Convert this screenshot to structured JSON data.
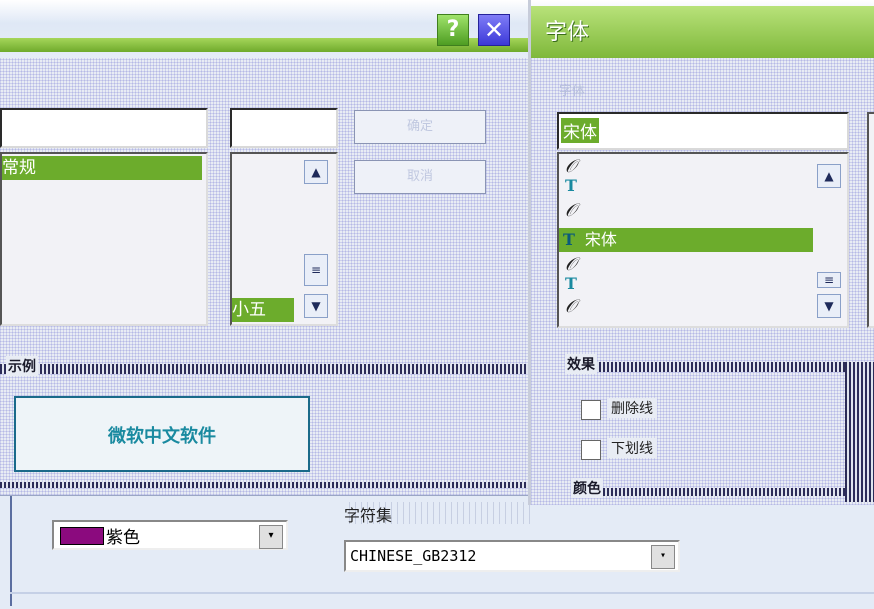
{
  "back_dialog": {
    "color_value": "紫色",
    "color_swatch": "#8b0a7e",
    "charset_label": "字符集",
    "charset_value": "CHINESE_GB2312",
    "dropdown_glyph": "▾"
  },
  "left_dialog": {
    "size_prefix": "小",
    "style_selected": "常规",
    "size_selected": "小五",
    "ok_label": "确定",
    "cancel_label": "取消",
    "preview_group": "示例",
    "preview_text": "微软中文软件",
    "help_glyph": "?",
    "close_glyph": "✕"
  },
  "right_dialog": {
    "title": "字体",
    "font_label": "字体",
    "font_input_value": "宋体",
    "font_selected": "宋体",
    "effects_group": "效果",
    "strikeout_label": "删除线",
    "underline_label": "下划线",
    "color_group": "颜色",
    "scroll_up": "▲",
    "scroll_down": "▼",
    "scroll_grip": "≡"
  },
  "colors": {
    "selection_green": "#6cac2c",
    "title_green": "#7fb83a",
    "close_blue": "#4a47e0",
    "preview_teal": "#1a8aa0"
  }
}
